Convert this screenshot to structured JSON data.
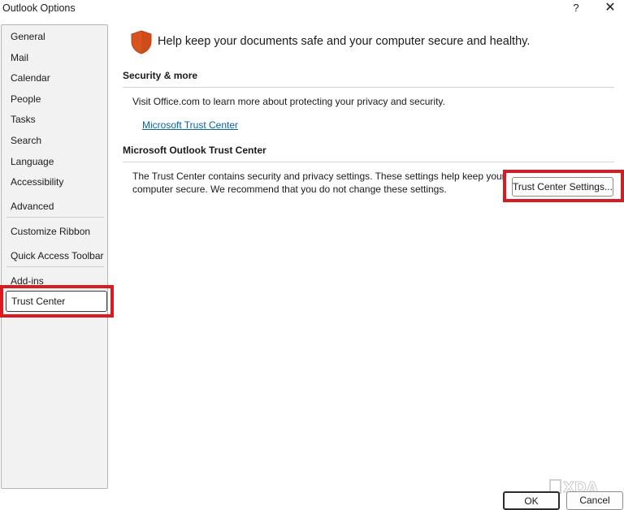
{
  "window": {
    "title": "Outlook Options",
    "help_glyph": "?",
    "close_glyph": "✕"
  },
  "sidebar": {
    "items": [
      {
        "label": "General"
      },
      {
        "label": "Mail"
      },
      {
        "label": "Calendar"
      },
      {
        "label": "People"
      },
      {
        "label": "Tasks"
      },
      {
        "label": "Search"
      },
      {
        "label": "Language"
      },
      {
        "label": "Accessibility"
      },
      {
        "label": "Advanced"
      },
      {
        "label": "Customize Ribbon"
      },
      {
        "label": "Quick Access Toolbar"
      },
      {
        "label": "Add-ins"
      },
      {
        "label": "Trust Center"
      }
    ],
    "selected": "Trust Center"
  },
  "main": {
    "headline": "Help keep your documents safe and your computer secure and healthy.",
    "security_section": {
      "title": "Security & more",
      "text": "Visit Office.com to learn more about protecting your privacy and security.",
      "link": "Microsoft Trust Center"
    },
    "trust_center_section": {
      "title": "Microsoft Outlook Trust Center",
      "text_line1": "The Trust Center contains security and privacy settings. These settings help keep your",
      "text_line2": "computer secure. We recommend that you do not change these settings.",
      "button": "Trust Center Settings..."
    }
  },
  "footer": {
    "ok": "OK",
    "cancel": "Cancel"
  },
  "colors": {
    "highlight": "#d81b20",
    "link": "#0563a6",
    "shield": "#d9531e"
  },
  "icons": {
    "shield": "shield-icon",
    "watermark": "xda-logo"
  },
  "watermark_text": "XDA"
}
